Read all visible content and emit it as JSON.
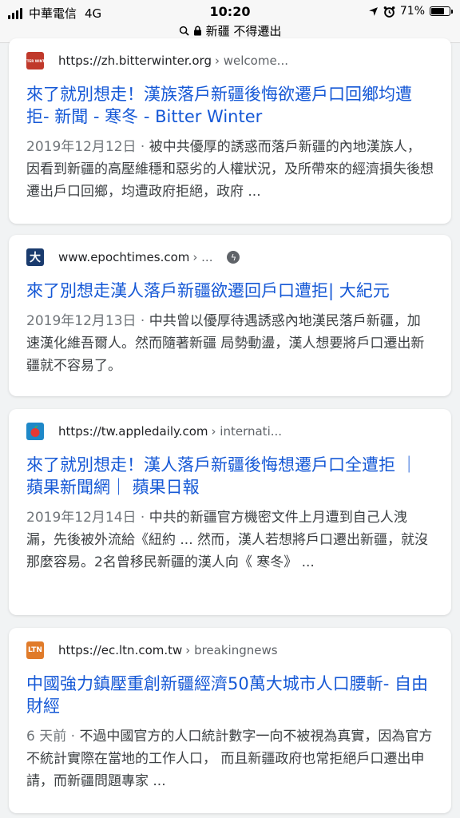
{
  "status_bar": {
    "carrier": "中華電信",
    "network": "4G",
    "time": "10:20",
    "battery": "71%",
    "battery_level": 0.71
  },
  "address_bar": {
    "query": "新疆 不得遷出"
  },
  "results": [
    {
      "url": "https://zh.bitterwinter.org",
      "path": "› welcome...",
      "favicon_text": "BITTER WINTER",
      "favicon_color": "#c0392b",
      "title": "來了就別想走！漢族落戶新疆後悔欲遷戶口回鄉均遭拒- 新聞 - 寒冬 - Bitter Winter",
      "date": "2019年12月12日 · ",
      "snippet": "被中共優厚的誘惑而落戶新疆的內地漢族人，因看到新疆的高壓維穩和惡劣的人權狀況，及所帶來的經濟損失後想遷出戶口回鄉，均遭政府拒絕，政府 ..."
    },
    {
      "url": "www.epochtimes.com",
      "path": "› ...",
      "favicon_text": "大",
      "favicon_color": "#1a3b6e",
      "has_amp": true,
      "title": "來了別想走漢人落戶新疆欲遷回戶口遭拒| 大紀元",
      "date": "2019年12月13日 · ",
      "snippet": "中共曾以優厚待遇誘惑內地漢民落戶新疆，加速漢化維吾爾人。然而隨著新疆 局勢動盪，漢人想要將戶口遷出新疆就不容易了。"
    },
    {
      "url": "https://tw.appledaily.com",
      "path": "› internati...",
      "favicon_text": "●",
      "favicon_color": "#1e88c8",
      "title": "來了就別想走！漢人落戶新疆後悔想遷戶口全遭拒 ｜ 蘋果新聞網｜ 蘋果日報",
      "date": "2019年12月14日 · ",
      "snippet": "中共的新疆官方機密文件上月遭到自己人洩漏，先後被外流給《紐約 ... 然而，漢人若想將戶口遷出新疆，就沒那麼容易。2名曾移民新疆的漢人向《 寒冬》 ..."
    },
    {
      "url": "https://ec.ltn.com.tw",
      "path": "› breakingnews",
      "favicon_text": "LTN",
      "favicon_color": "#e07b2a",
      "title": "中國強力鎮壓重創新疆經濟50萬大城市人口腰斬- 自由財經",
      "date": "6 天前 · ",
      "snippet": "不過中國官方的人口統計數字一向不被視為真實，因為官方不統計實際在當地的工作人口， 而且新疆政府也常拒絕戶口遷出申請，而新疆問題專家 ..."
    }
  ]
}
